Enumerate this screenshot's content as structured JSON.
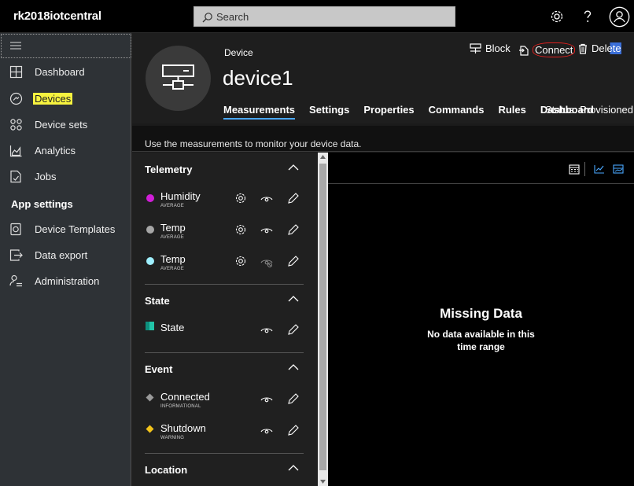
{
  "topbar": {
    "app_title": "rk2018iotcentral",
    "search_placeholder": "Search",
    "icons": [
      "settings-icon",
      "help-icon",
      "user-icon"
    ]
  },
  "sidebar": {
    "items": [
      {
        "label": "Dashboard",
        "icon": "dashboard-icon"
      },
      {
        "label": "Devices",
        "icon": "devices-icon",
        "highlighted": true
      },
      {
        "label": "Device sets",
        "icon": "device-sets-icon"
      },
      {
        "label": "Analytics",
        "icon": "analytics-icon"
      },
      {
        "label": "Jobs",
        "icon": "jobs-icon"
      }
    ],
    "section_title": "App settings",
    "settings_items": [
      {
        "label": "Device Templates",
        "icon": "device-templates-icon"
      },
      {
        "label": "Data export",
        "icon": "data-export-icon"
      },
      {
        "label": "Administration",
        "icon": "administration-icon"
      }
    ]
  },
  "device": {
    "type_label": "Device",
    "name": "device1",
    "actions": {
      "block": "Block",
      "connect": "Connect",
      "delete": "Delete"
    },
    "tabs": [
      "Measurements",
      "Settings",
      "Properties",
      "Commands",
      "Rules",
      "Dashboard"
    ],
    "active_tab": "Measurements",
    "status": "Status: Provisioned"
  },
  "hint": "Use the measurements to monitor your device data.",
  "measurements": {
    "telemetry": {
      "title": "Telemetry",
      "items": [
        {
          "name": "Humidity",
          "sub": "AVERAGE",
          "color": "#d11ed8",
          "visible": true
        },
        {
          "name": "Temp",
          "sub": "AVERAGE",
          "color": "#a6a6a6",
          "visible": true
        },
        {
          "name": "Temp",
          "sub": "AVERAGE",
          "color": "#9ff0ff",
          "visible": false
        }
      ]
    },
    "state": {
      "title": "State",
      "items": [
        {
          "name": "State",
          "color": "#22c4a8"
        }
      ]
    },
    "event": {
      "title": "Event",
      "items": [
        {
          "name": "Connected",
          "sub": "INFORMATIONAL",
          "color": "#9a9a9a"
        },
        {
          "name": "Shutdown",
          "sub": "WARNING",
          "color": "#f3c31a"
        }
      ]
    },
    "location": {
      "title": "Location"
    }
  },
  "chart_panel": {
    "title": "Missing Data",
    "message": "No data available in this time range"
  }
}
